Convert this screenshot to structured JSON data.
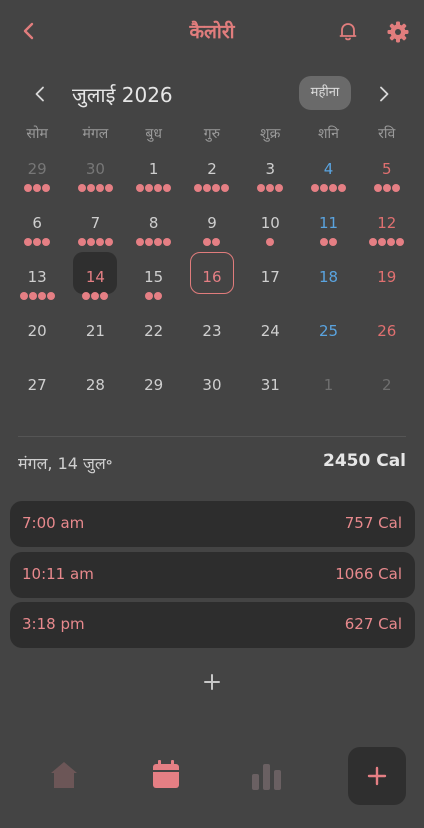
{
  "app": {
    "title": "कैलोरी"
  },
  "icons": {
    "back": "chevron-left-icon",
    "notifications": "bell-icon",
    "settings": "gear-icon",
    "prev_month": "chevron-left-icon",
    "next_month": "chevron-right-icon",
    "add_entry": "plus-icon",
    "home": "home-icon",
    "calendar": "calendar-icon",
    "stats": "bar-chart-icon",
    "fab": "plus-icon"
  },
  "colors": {
    "background": "#444444",
    "accent": "#e57f84",
    "saturday": "#5aa4e0",
    "sunday": "#e07070",
    "card": "#2d2d2d"
  },
  "calendar": {
    "month_label": "जुलाई 2026",
    "view_toggle": "महीना",
    "weekdays": [
      "सोम",
      "मंगल",
      "बुध",
      "गुरु",
      "शुक्र",
      "शनि",
      "रवि"
    ],
    "weeks": [
      [
        {
          "day": "29",
          "dots": 3,
          "outside": true
        },
        {
          "day": "30",
          "dots": 4,
          "outside": true
        },
        {
          "day": "1",
          "dots": 4
        },
        {
          "day": "2",
          "dots": 4
        },
        {
          "day": "3",
          "dots": 3
        },
        {
          "day": "4",
          "dots": 4
        },
        {
          "day": "5",
          "dots": 3
        }
      ],
      [
        {
          "day": "6",
          "dots": 3
        },
        {
          "day": "7",
          "dots": 4
        },
        {
          "day": "8",
          "dots": 4
        },
        {
          "day": "9",
          "dots": 2
        },
        {
          "day": "10",
          "dots": 1
        },
        {
          "day": "11",
          "dots": 2
        },
        {
          "day": "12",
          "dots": 4
        }
      ],
      [
        {
          "day": "13",
          "dots": 4
        },
        {
          "day": "14",
          "dots": 3,
          "selected": true
        },
        {
          "day": "15",
          "dots": 2
        },
        {
          "day": "16",
          "dots": 0,
          "today": true
        },
        {
          "day": "17",
          "dots": 0
        },
        {
          "day": "18",
          "dots": 0
        },
        {
          "day": "19",
          "dots": 0
        }
      ],
      [
        {
          "day": "20",
          "dots": 0
        },
        {
          "day": "21",
          "dots": 0
        },
        {
          "day": "22",
          "dots": 0
        },
        {
          "day": "23",
          "dots": 0
        },
        {
          "day": "24",
          "dots": 0
        },
        {
          "day": "25",
          "dots": 0
        },
        {
          "day": "26",
          "dots": 0
        }
      ],
      [
        {
          "day": "27",
          "dots": 0
        },
        {
          "day": "28",
          "dots": 0
        },
        {
          "day": "29",
          "dots": 0
        },
        {
          "day": "30",
          "dots": 0
        },
        {
          "day": "31",
          "dots": 0
        },
        {
          "day": "1",
          "dots": 0,
          "outside": true
        },
        {
          "day": "2",
          "dots": 0,
          "outside": true
        }
      ]
    ]
  },
  "summary": {
    "date": "मंगल, 14 जुल॰",
    "total": "2450 Cal"
  },
  "entries": [
    {
      "time": "7:00 am",
      "calories": "757 Cal"
    },
    {
      "time": "10:11 am",
      "calories": "1066 Cal"
    },
    {
      "time": "3:18 pm",
      "calories": "627 Cal"
    }
  ]
}
